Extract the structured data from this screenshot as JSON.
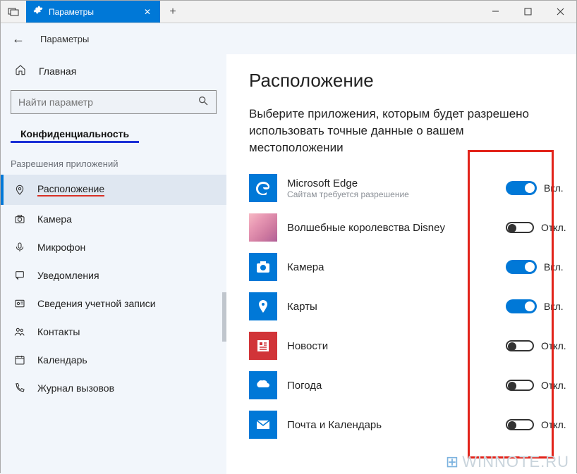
{
  "titlebar": {
    "tab_label": "Параметры",
    "new_tab": "+"
  },
  "apphdr": {
    "title": "Параметры"
  },
  "sidebar": {
    "home": "Главная",
    "search_placeholder": "Найти параметр",
    "section": "Конфиденциальность",
    "subhead": "Разрешения приложений",
    "items": [
      {
        "label": "Расположение",
        "selected": true,
        "redline": true,
        "icon": "location"
      },
      {
        "label": "Камера",
        "icon": "camera"
      },
      {
        "label": "Микрофон",
        "icon": "mic"
      },
      {
        "label": "Уведомления",
        "icon": "bell"
      },
      {
        "label": "Сведения учетной записи",
        "icon": "account"
      },
      {
        "label": "Контакты",
        "icon": "contacts"
      },
      {
        "label": "Календарь",
        "icon": "calendar"
      },
      {
        "label": "Журнал вызовов",
        "icon": "calllog"
      }
    ]
  },
  "main": {
    "heading": "Расположение",
    "lead": "Выберите приложения, которым будет разрешено использовать точные данные о вашем местоположении",
    "on_label": "Вкл.",
    "off_label": "Откл.",
    "apps": [
      {
        "name": "Microsoft Edge",
        "sub": "Сайтам требуется разрешение",
        "on": true,
        "icon": "edge"
      },
      {
        "name": "Волшебные королевства Disney",
        "on": false,
        "icon": "disney"
      },
      {
        "name": "Камера",
        "on": true,
        "icon": "camera"
      },
      {
        "name": "Карты",
        "on": true,
        "icon": "maps"
      },
      {
        "name": "Новости",
        "on": false,
        "icon": "news"
      },
      {
        "name": "Погода",
        "on": false,
        "icon": "weather"
      },
      {
        "name": "Почта и Календарь",
        "on": false,
        "icon": "mail"
      }
    ]
  },
  "watermark": "WINNOTE.RU"
}
